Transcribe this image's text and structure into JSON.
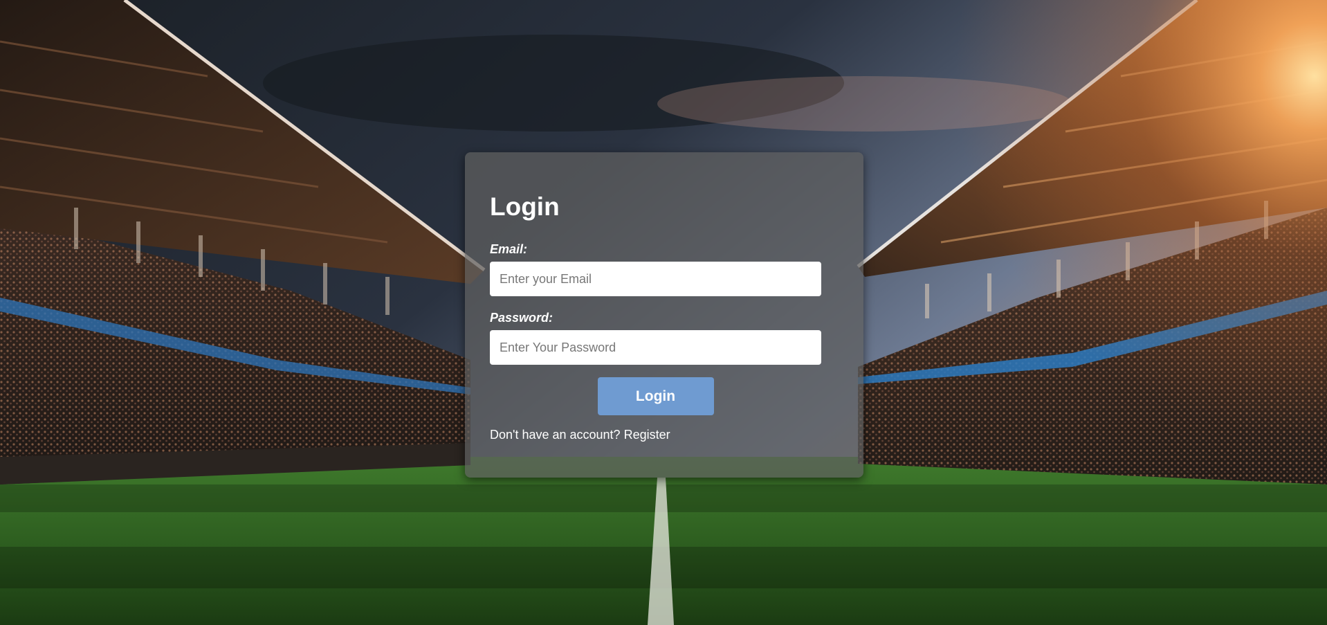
{
  "login": {
    "title": "Login",
    "email_label": "Email:",
    "email_placeholder": "Enter your Email",
    "password_label": "Password:",
    "password_placeholder": "Enter Your Password",
    "submit_label": "Login",
    "register_prompt": "Don't have an account?",
    "register_link": "Register"
  },
  "colors": {
    "button": "#6f9bd1",
    "card": "#5f5f5f",
    "field": "#ffffff"
  }
}
